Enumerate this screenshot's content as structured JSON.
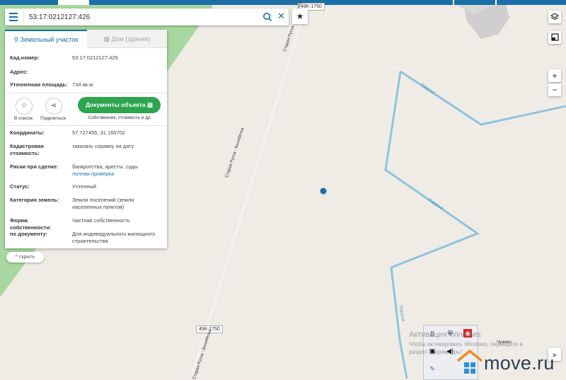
{
  "search": {
    "value": "53:17:0212127:426",
    "placeholder": ""
  },
  "tabs": [
    {
      "label": "Земельный участок",
      "icon": "person-pin-icon",
      "active": true
    },
    {
      "label": "Дом (здание)",
      "icon": "building-icon",
      "active": false
    }
  ],
  "info_top": [
    {
      "label": "Кад.номер:",
      "value": "53:17:0212127:426",
      "link": true
    },
    {
      "label": "Адрес:",
      "value": ""
    },
    {
      "label": "Уточненная площадь:",
      "value": "734 кв.м"
    }
  ],
  "actions": {
    "add_list": "В список",
    "share": "Поделиться",
    "documents": "Документы объекта",
    "documents_sub": "Собственник, стоимость и др."
  },
  "info": {
    "coords_label": "Координаты:",
    "coords_value": "57.727455, 31.165702",
    "cadastral_label": "Кадастровая стоимость:",
    "cadastral_value": "заказать справку на дату",
    "risks_label": "Риски при сделке:",
    "risks_value": "банкротства, аресты, суды",
    "risks_link": "полная проверка",
    "status_label": "Статус:",
    "status_value": "Учтенный",
    "category_label": "Категория земель:",
    "category_value": "Земли поселений (земли населенных пунктов)",
    "ownership_label": "Форма собственности:",
    "ownership_value": "Частная собственность",
    "bydoc_label": "по документу:",
    "bydoc_value": "Для индивидуального жилищного строительства"
  },
  "hide_button": "скрыть",
  "map": {
    "road_badge_top": "49К-1750",
    "road_badge_bottom": "49К-1750",
    "road_name": "Старая Русса - Белебёлка",
    "river_name": "Порусья",
    "village": "Чужово"
  },
  "zoom": {
    "in": "+",
    "out": "−"
  },
  "watermark": {
    "line1": "Активация Windows",
    "line2": "Чтобы активировать Windows, перейдите в",
    "line3": "раздел \"Параметры\"."
  },
  "brand": "move.ru",
  "colors": {
    "accent": "#1b6fa8",
    "green": "#2ea44f",
    "river": "#8fc3dd",
    "forest": "#9fd39a"
  }
}
